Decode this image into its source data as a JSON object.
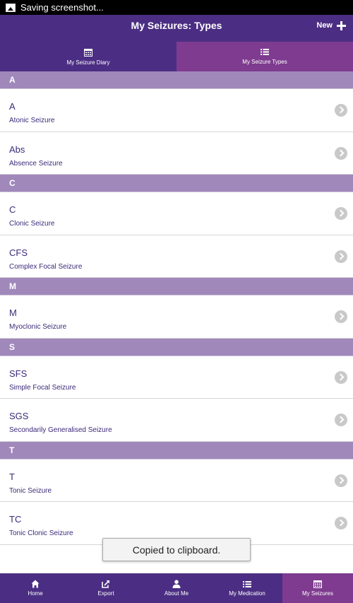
{
  "status_bar": {
    "text": "Saving screenshot..."
  },
  "header": {
    "title": "My Seizures: Types",
    "new_label": "New"
  },
  "tabs": [
    {
      "label": "My Seizure Diary",
      "icon": "calendar-icon"
    },
    {
      "label": "My Seizure Types",
      "icon": "list-icon",
      "active": true
    }
  ],
  "sections": [
    {
      "letter": "A",
      "items": [
        {
          "code": "A",
          "name": "Atonic Seizure"
        },
        {
          "code": "Abs",
          "name": "Absence Seizure"
        }
      ]
    },
    {
      "letter": "C",
      "items": [
        {
          "code": "C",
          "name": "Clonic Seizure"
        },
        {
          "code": "CFS",
          "name": "Complex Focal Seizure"
        }
      ]
    },
    {
      "letter": "M",
      "items": [
        {
          "code": "M",
          "name": "Myoclonic Seizure"
        }
      ]
    },
    {
      "letter": "S",
      "items": [
        {
          "code": "SFS",
          "name": "Simple Focal Seizure"
        },
        {
          "code": "SGS",
          "name": "Secondarily Generalised Seizure"
        }
      ]
    },
    {
      "letter": "T",
      "items": [
        {
          "code": "T",
          "name": "Tonic Seizure"
        },
        {
          "code": "TC",
          "name": "Tonic Clonic Seizure"
        }
      ]
    }
  ],
  "toast": {
    "text": "Copied to clipboard."
  },
  "bottom_nav": [
    {
      "label": "Home",
      "icon": "home-icon"
    },
    {
      "label": "Export",
      "icon": "export-icon"
    },
    {
      "label": "About Me",
      "icon": "person-icon"
    },
    {
      "label": "My Medication",
      "icon": "list-icon"
    },
    {
      "label": "My Seizures",
      "icon": "calendar-icon",
      "active": true
    }
  ],
  "colors": {
    "primary": "#4b2e83",
    "active": "#7e3b8f",
    "section": "#a088bb",
    "text": "#3c2a79"
  }
}
